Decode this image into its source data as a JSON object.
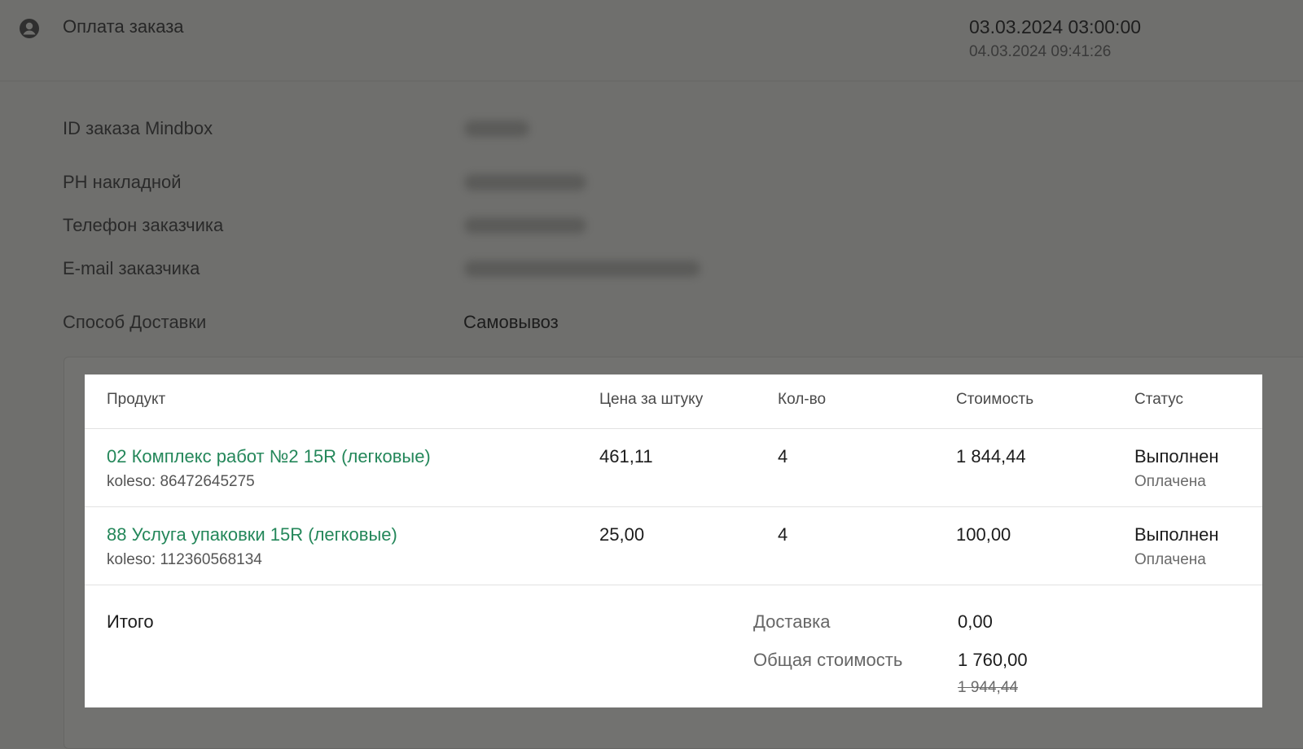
{
  "header": {
    "event_title": "Оплата заказа",
    "datetime_primary": "03.03.2024 03:00:00",
    "datetime_secondary": "04.03.2024 09:41:26",
    "icon": "user-circle-icon"
  },
  "fields": [
    {
      "label": "ID заказа Mindbox",
      "value": ""
    },
    {
      "label": "РН накладной",
      "value": ""
    },
    {
      "label": "Телефон заказчика",
      "value": ""
    },
    {
      "label": "E-mail заказчика",
      "value": ""
    },
    {
      "label": "Способ Доставки",
      "value": "Самовывоз"
    }
  ],
  "table": {
    "columns": [
      "Продукт",
      "Цена за штуку",
      "Кол-во",
      "Стоимость",
      "Статус"
    ],
    "rows": [
      {
        "product": "02 Комплекс работ №2 15R (легковые)",
        "sku": "koleso: 86472645275",
        "price": "461,11",
        "qty": "4",
        "cost": "1 844,44",
        "status": "Выполнен",
        "payment": "Оплачена"
      },
      {
        "product": "88 Услуга упаковки 15R (легковые)",
        "sku": "koleso: 112360568134",
        "price": "25,00",
        "qty": "4",
        "cost": "100,00",
        "status": "Выполнен",
        "payment": "Оплачена"
      }
    ]
  },
  "totals": {
    "title": "Итого",
    "delivery_label": "Доставка",
    "delivery_value": "0,00",
    "total_label": "Общая стоимость",
    "total_value": "1 760,00",
    "total_original": "1 944,44"
  },
  "colors": {
    "link": "#24875a",
    "overlay": "#6f6f6d"
  }
}
